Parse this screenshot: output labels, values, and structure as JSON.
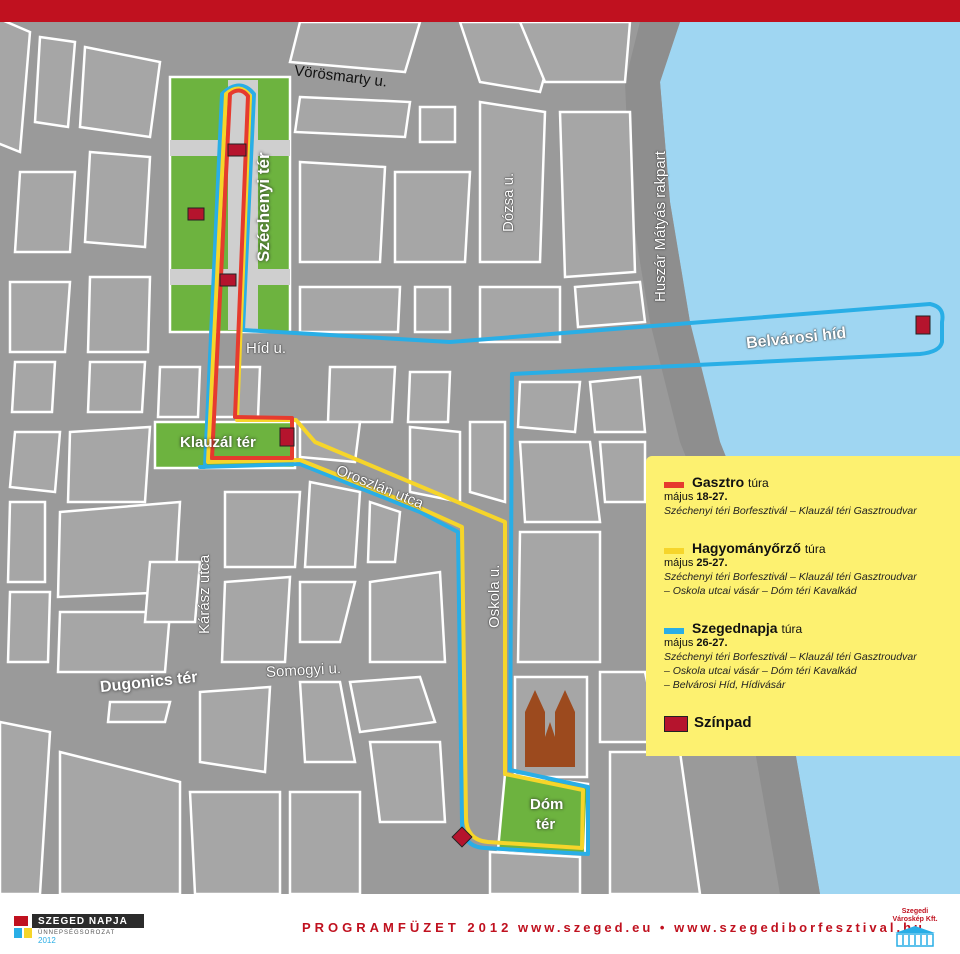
{
  "streets": {
    "vorosmarty": "Vörösmarty u.",
    "dozsa": "Dózsa u.",
    "huszar": "Huszár Mátyás rakpart",
    "hid": "Híd u.",
    "belvarosi_hid": "Belvárosi híd",
    "oroszlan": "Oroszlán utca",
    "oskola": "Oskola u.",
    "karasz": "Kárász utca",
    "somogyi": "Somogyi u."
  },
  "squares": {
    "szechenyi": "Széchenyi tér",
    "klauzal": "Klauzál tér",
    "dugonics": "Dugonics tér",
    "dom_line1": "Dóm",
    "dom_line2": "tér"
  },
  "legend": {
    "colors": {
      "gasztro": "#e63b2e",
      "hagyomany": "#f6d52a",
      "szegednapja": "#29aee6",
      "szinpad": "#b5142d"
    },
    "items": [
      {
        "title": "Gasztro",
        "suffix": "túra",
        "date_prefix": "május",
        "date": "18-27.",
        "desc": [
          "Széchenyi téri Borfesztivál – Klauzál téri Gasztroudvar"
        ]
      },
      {
        "title": "Hagyományőrző",
        "suffix": "túra",
        "date_prefix": "május",
        "date": "25-27.",
        "desc": [
          "Széchenyi téri Borfesztivál – Klauzál téri Gasztroudvar",
          "– Oskola utcai vásár – Dóm téri Kavalkád"
        ]
      },
      {
        "title": "Szegednapja",
        "suffix": "túra",
        "date_prefix": "május",
        "date": "26-27.",
        "desc": [
          "Széchenyi téri Borfesztivál – Klauzál téri Gasztroudvar",
          "– Oskola utcai vásár – Dóm téri Kavalkád",
          "– Belvárosi Híd, Hídivásár"
        ]
      }
    ],
    "stage_label": "Színpad"
  },
  "footer": {
    "logo_title": "SZEGED NAPJA",
    "logo_sub": "ÜNNEPSÉGSOROZAT",
    "logo_year": "2012",
    "program": "PROGRAMFÜZET 2012",
    "urls": "www.szeged.eu • www.szegediborfesztival.hu",
    "right_logo_line1": "Szegedi",
    "right_logo_line2": "Városkép Kft."
  }
}
